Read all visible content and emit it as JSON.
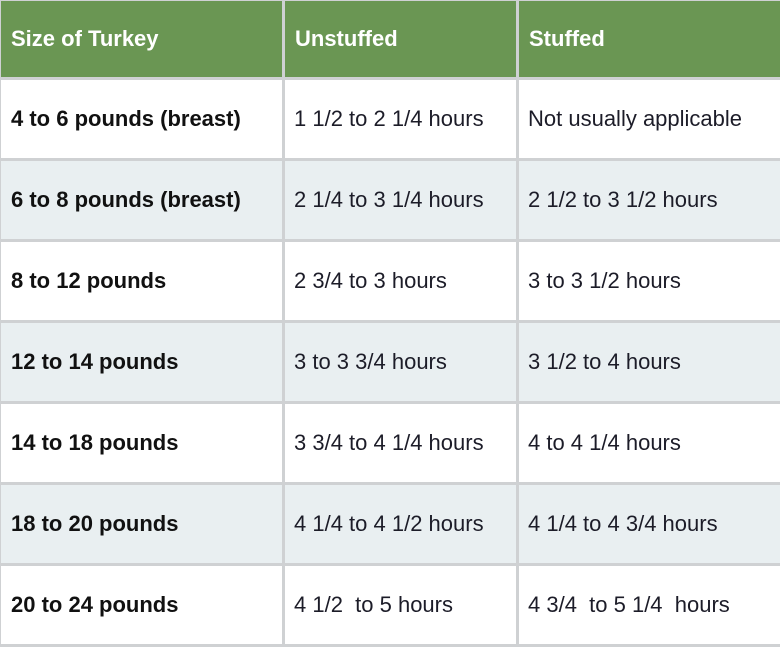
{
  "table": {
    "headers": [
      "Size of Turkey",
      "Unstuffed",
      "Stuffed"
    ],
    "rows": [
      [
        "4 to 6 pounds (breast)",
        "1 1/2 to 2 1/4 hours",
        "Not usually applicable"
      ],
      [
        "6 to 8 pounds (breast)",
        "2 1/4 to 3 1/4 hours",
        "2 1/2 to 3 1/2 hours"
      ],
      [
        "8 to 12 pounds",
        "2 3/4 to 3 hours",
        "3 to 3 1/2 hours"
      ],
      [
        "12 to 14 pounds",
        "3 to 3 3/4 hours",
        "3 1/2 to 4 hours"
      ],
      [
        "14 to 18 pounds",
        "3 3/4 to 4 1/4 hours",
        "4 to 4 1/4 hours"
      ],
      [
        "18 to 20 pounds",
        "4 1/4 to 4 1/2 hours",
        "4 1/4 to 4 3/4 hours"
      ],
      [
        "20 to 24 pounds",
        "4 1/2  to 5 hours",
        "4 3/4  to 5 1/4  hours"
      ]
    ]
  },
  "colors": {
    "header_bg": "#6a9653",
    "header_text": "#ffffff",
    "alt_row_bg": "#e9eff1",
    "border": "#cfd1d3"
  }
}
